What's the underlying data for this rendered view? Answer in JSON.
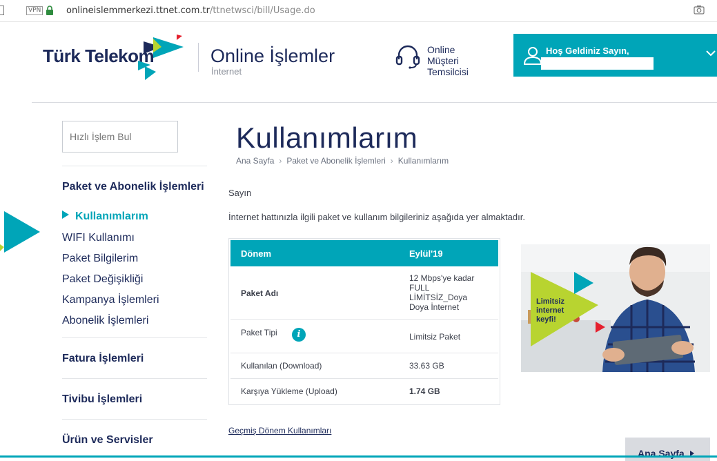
{
  "browser": {
    "vpn_label": "VPN",
    "url_domain": "onlineislemmerkezi.ttnet.com.tr",
    "url_path": "/ttnetwsci/bill/Usage.do"
  },
  "header": {
    "brand": "Türk Telekom",
    "app_title": "Online İşlemler",
    "app_subtitle": "İnternet",
    "rep_line1": "Online",
    "rep_line2": "Müşteri",
    "rep_line3": "Temsilcisi",
    "welcome": "Hoş Geldiniz Sayın,"
  },
  "sidebar": {
    "search_placeholder": "Hızlı İşlem Bul",
    "section1": "Paket ve Abonelik İşlemleri",
    "items": [
      {
        "label": "Kullanımlarım",
        "active": true
      },
      {
        "label": "WIFI Kullanımı"
      },
      {
        "label": "Paket Bilgilerim"
      },
      {
        "label": "Paket Değişikliği"
      },
      {
        "label": "Kampanya İşlemleri"
      },
      {
        "label": "Abonelik İşlemleri"
      }
    ],
    "section2": "Fatura İşlemleri",
    "section3": "Tivibu İşlemleri",
    "section4": "Ürün ve Servisler"
  },
  "main": {
    "title": "Kullanımlarım",
    "breadcrumb": [
      "Ana Sayfa",
      "Paket ve Abonelik İşlemleri",
      "Kullanımlarım"
    ],
    "greeting": "Sayın",
    "intro": "İnternet hattınızla ilgili paket ve kullanım bilgileriniz aşağıda yer almaktadır.",
    "table": {
      "header_left": "Dönem",
      "header_right": "Eylül'19",
      "rows": [
        {
          "label": "Paket Adı",
          "value_lines": [
            "12 Mbps'ye kadar",
            "FULL",
            "LİMİTSİZ_Doya",
            "Doya İnternet"
          ]
        },
        {
          "label": "Paket Tipi",
          "value": "Limitsiz Paket"
        },
        {
          "label": "Kullanılan (Download)",
          "value": "33.63 GB"
        },
        {
          "label": "Karşıya Yükleme (Upload)",
          "value": "1.74 GB"
        }
      ]
    },
    "past_link": "Geçmiş Dönem Kullanımları",
    "home_button": "Ana Sayfa",
    "promo_text": [
      "Limitsiz",
      "internet",
      "keyfi!"
    ]
  },
  "colors": {
    "accent": "#00a5b8",
    "brand_navy": "#1d2a5a",
    "promo_green": "#b8d430"
  },
  "icons": [
    "lock-icon",
    "camera-icon",
    "headset-icon",
    "user-icon",
    "chevron-down-icon",
    "info-icon",
    "play-arrow-icon"
  ]
}
